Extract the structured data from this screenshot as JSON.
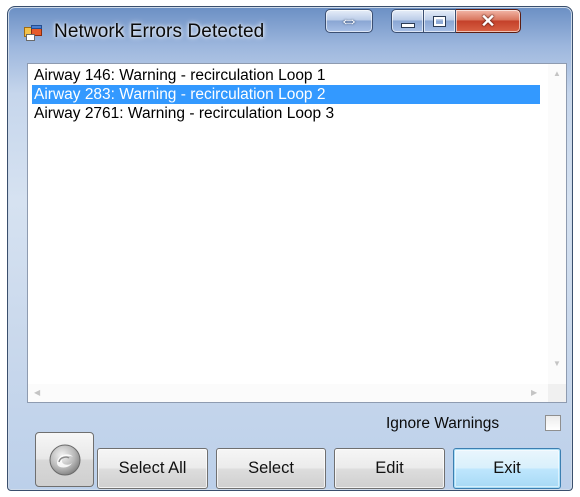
{
  "window": {
    "title": "Network Errors Detected"
  },
  "list": {
    "items": [
      {
        "label": "Airway 146: Warning - recirculation Loop 1",
        "selected": false
      },
      {
        "label": "Airway 283: Warning - recirculation Loop 2",
        "selected": true
      },
      {
        "label": "Airway 2761: Warning - recirculation Loop 3",
        "selected": false
      }
    ]
  },
  "options": {
    "ignore_warnings_label": "Ignore Warnings",
    "ignore_warnings_checked": false
  },
  "buttons": {
    "select_all": "Select All",
    "select": "Select",
    "edit": "Edit",
    "exit": "Exit"
  },
  "colors": {
    "selection": "#3399ff",
    "close_button": "#c4412a",
    "default_button_border": "#3c7fb1"
  },
  "icons": {
    "app": "app-window-icon",
    "round_button": "swirl-icon"
  }
}
